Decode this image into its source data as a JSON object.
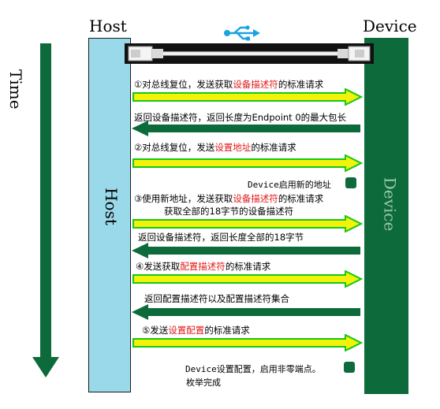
{
  "header": {
    "host": "Host",
    "device": "Device"
  },
  "time_label": "Time",
  "columns": {
    "host": "Host",
    "device": "Device"
  },
  "icon": "usb-icon",
  "colors": {
    "host": "#99d9ea",
    "device": "#0d6a3a",
    "arrow_right_fill": "#f2f20a",
    "arrow_right_edge": "#14c814",
    "arrow_left": "#0d6a3a",
    "time_arrow": "#0d6a3a",
    "highlight": "#e01a1a"
  },
  "messages": [
    {
      "pre": "①对总线复位，发送获取",
      "hl": "设备描述符",
      "post": "的标准请求",
      "dir": "right"
    },
    {
      "text": "返回设备描述符，返回长度为Endpoint 0的最大包长",
      "dir": "left"
    },
    {
      "pre": "②对总线复位，发送",
      "hl": "设置地址",
      "post": "的标准请求",
      "dir": "right"
    },
    {
      "note": "Device启用新的地址"
    },
    {
      "pre": "③使用新地址，发送获取",
      "hl": "设备描述符",
      "post": "的标准请求",
      "line2": "获取全部的18字节的设备描述符",
      "dir": "right"
    },
    {
      "text": "返回设备描述符，返回长度全部的18字节",
      "dir": "left"
    },
    {
      "pre": "④发送获取",
      "hl": "配置描述符",
      "post": "的标准请求",
      "dir": "right"
    },
    {
      "text": "返回配置描述符以及配置描述符集合",
      "dir": "left"
    },
    {
      "pre": "⑤发送",
      "hl": "设置配置",
      "post": "的标准请求",
      "dir": "right"
    },
    {
      "note": "Device设置配置，启用非零端点。",
      "note2": "枚举完成"
    }
  ]
}
